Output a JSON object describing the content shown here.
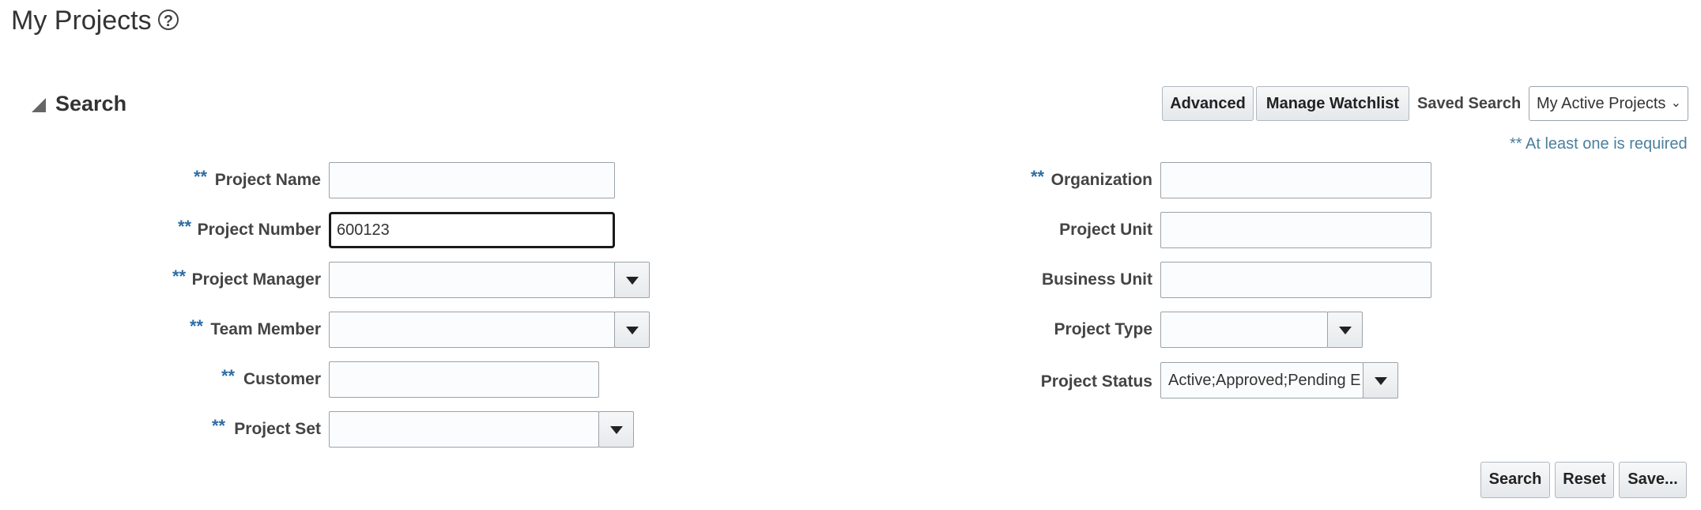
{
  "page": {
    "title": "My Projects",
    "help_icon": "?"
  },
  "search": {
    "heading": "Search",
    "buttons": {
      "advanced": "Advanced",
      "manage_watchlist": "Manage Watchlist"
    },
    "saved_search_label": "Saved Search",
    "saved_search_value": "My Active Projects",
    "required_note": "** At least one is required",
    "required_marker": "**"
  },
  "left_fields": {
    "project_name": {
      "label": "Project Name",
      "value": ""
    },
    "project_number": {
      "label": "Project Number",
      "value": "600123"
    },
    "project_manager": {
      "label": "Project Manager",
      "value": ""
    },
    "team_member": {
      "label": "Team Member",
      "value": ""
    },
    "customer": {
      "label": "Customer",
      "value": ""
    },
    "project_set": {
      "label": "Project Set",
      "value": ""
    }
  },
  "right_fields": {
    "organization": {
      "label": "Organization",
      "value": ""
    },
    "project_unit": {
      "label": "Project Unit",
      "value": ""
    },
    "business_unit": {
      "label": "Business Unit",
      "value": ""
    },
    "project_type": {
      "label": "Project Type",
      "value": ""
    },
    "project_status": {
      "label": "Project Status",
      "value": "Active;Approved;Pending E"
    }
  },
  "actions": {
    "search": "Search",
    "reset": "Reset",
    "save": "Save..."
  },
  "colors": {
    "required_marker": "#2e6da4",
    "note": "#4a7f9c"
  },
  "icons": [
    "help-icon",
    "collapse-triangle-icon",
    "chevron-down-icon",
    "dropdown-caret-icon"
  ]
}
